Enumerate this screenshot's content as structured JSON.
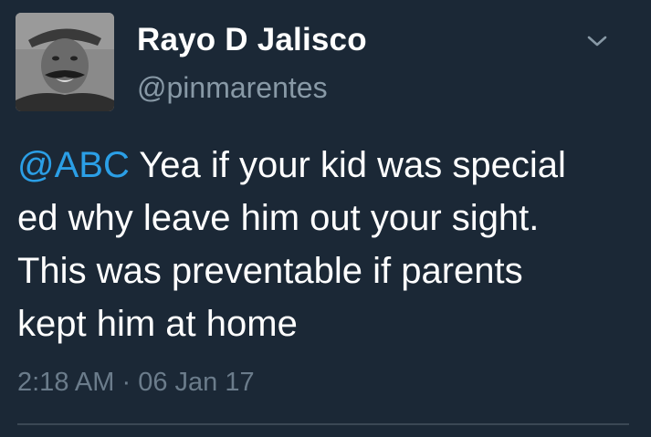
{
  "tweet": {
    "display_name": "Rayo D Jalisco",
    "handle": "@pinmarentes",
    "mention": "@ABC",
    "text_line1": " Yea if your kid was special",
    "text_line2": "ed why leave him out your sight.",
    "text_line3": "This was preventable if parents",
    "text_line4": "kept him at home",
    "time": "2:18 AM",
    "separator": "·",
    "date": "06 Jan 17"
  },
  "icons": {
    "menu": "chevron-down-icon",
    "avatar": "profile-photo"
  },
  "colors": {
    "background": "#1b2836",
    "text": "#ffffff",
    "secondary": "#8899a6",
    "link": "#2b9fe6"
  }
}
